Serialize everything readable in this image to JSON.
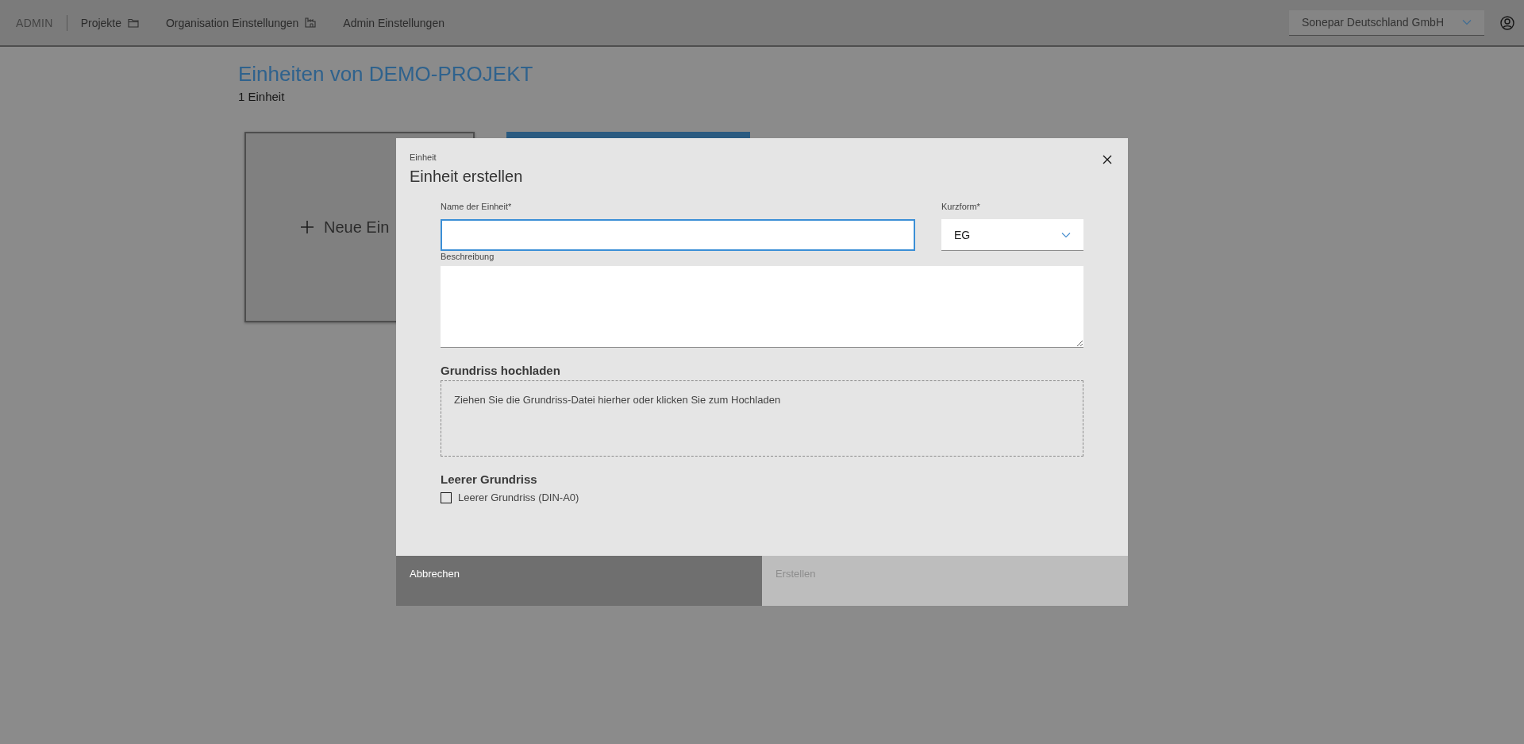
{
  "header": {
    "brand": "ADMIN",
    "nav": [
      {
        "label": "Projekte"
      },
      {
        "label": "Organisation Einstellungen"
      },
      {
        "label": "Admin Einstellungen"
      }
    ],
    "organization": {
      "value": "Sonepar Deutschland GmbH"
    }
  },
  "page": {
    "title": "Einheiten von DEMO-PROJEKT",
    "count": "1 Einheit",
    "cards": [
      {
        "kind": "new",
        "label": "Neue Ein"
      },
      {
        "kind": "unit"
      }
    ]
  },
  "dialog": {
    "overline": "Einheit",
    "title": "Einheit erstellen",
    "name_field": {
      "label": "Name der Einheit*",
      "focused": true
    },
    "short_field": {
      "label": "Kurzform*",
      "value": "EG"
    },
    "description_field": {
      "label": "Beschreibung"
    },
    "upload": {
      "heading": "Grundriss hochladen",
      "text": "Ziehen Sie die Grundriss-Datei hierher oder klicken Sie zum Hochladen"
    },
    "blank": {
      "heading": "Leerer Grundriss",
      "label": "Leerer Grundriss (DIN-A0)",
      "checked": false
    },
    "buttons": [
      {
        "label": "Abbrechen",
        "kind": "secondary",
        "disabled": false
      },
      {
        "label": "Erstellen",
        "kind": "primary",
        "disabled": true
      }
    ]
  }
}
